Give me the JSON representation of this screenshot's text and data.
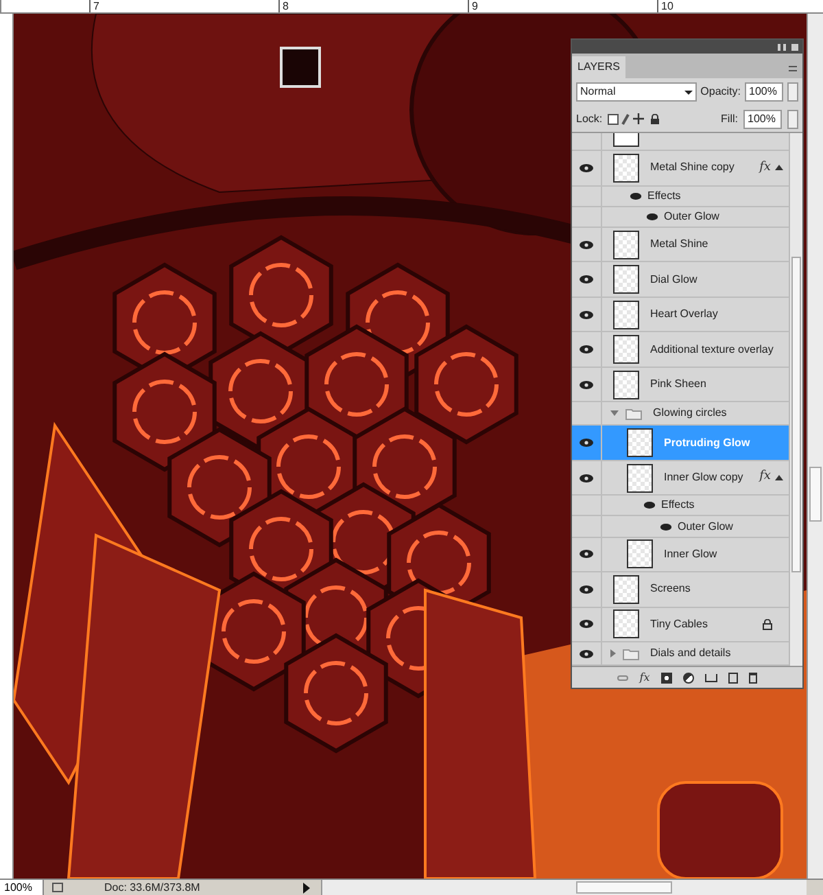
{
  "rulers": {
    "top_labels": [
      "7",
      "8",
      "9",
      "10"
    ]
  },
  "layers_panel": {
    "tab": "LAYERS",
    "blend_mode": "Normal",
    "opacity_label": "Opacity:",
    "opacity": "100%",
    "lock_label": "Lock:",
    "fill_label": "Fill:",
    "fill": "100%",
    "toolbar_fx": "fx",
    "layers": [
      {
        "kind": "layer",
        "name": "Metal Shine copy",
        "visible": true,
        "selected": false,
        "locked": false,
        "fx": "fx",
        "effects_label": "Effects",
        "effects": [
          {
            "name": "Outer Glow",
            "visible": true
          }
        ]
      },
      {
        "kind": "layer",
        "name": "Metal Shine",
        "visible": true,
        "selected": false,
        "locked": false
      },
      {
        "kind": "layer",
        "name": "Dial Glow",
        "visible": true,
        "selected": false,
        "locked": false
      },
      {
        "kind": "layer",
        "name": "Heart Overlay",
        "visible": true,
        "selected": false,
        "locked": false
      },
      {
        "kind": "layer",
        "name": "Additional texture overlay",
        "visible": true,
        "selected": false,
        "locked": false
      },
      {
        "kind": "layer",
        "name": "Pink Sheen",
        "visible": true,
        "selected": false,
        "locked": false
      },
      {
        "kind": "group",
        "name": "Glowing circles",
        "visible": false,
        "selected": false,
        "expanded": true,
        "children": [
          {
            "kind": "layer",
            "name": "Protruding Glow",
            "visible": true,
            "selected": true,
            "locked": false
          },
          {
            "kind": "layer",
            "name": "Inner Glow copy",
            "visible": true,
            "selected": false,
            "locked": false,
            "fx": "fx",
            "effects_label": "Effects",
            "effects": [
              {
                "name": "Outer Glow",
                "visible": true
              }
            ]
          },
          {
            "kind": "layer",
            "name": "Inner Glow",
            "visible": true,
            "selected": false,
            "locked": false
          }
        ]
      },
      {
        "kind": "layer",
        "name": "Screens",
        "visible": true,
        "selected": false,
        "locked": false
      },
      {
        "kind": "layer",
        "name": "Tiny Cables",
        "visible": true,
        "selected": false,
        "locked": true
      },
      {
        "kind": "group",
        "name": "Dials and details",
        "visible": true,
        "selected": false,
        "expanded": false
      }
    ]
  },
  "status_bar": {
    "zoom": "100%",
    "doc": "Doc: 33.6M/373.8M"
  }
}
